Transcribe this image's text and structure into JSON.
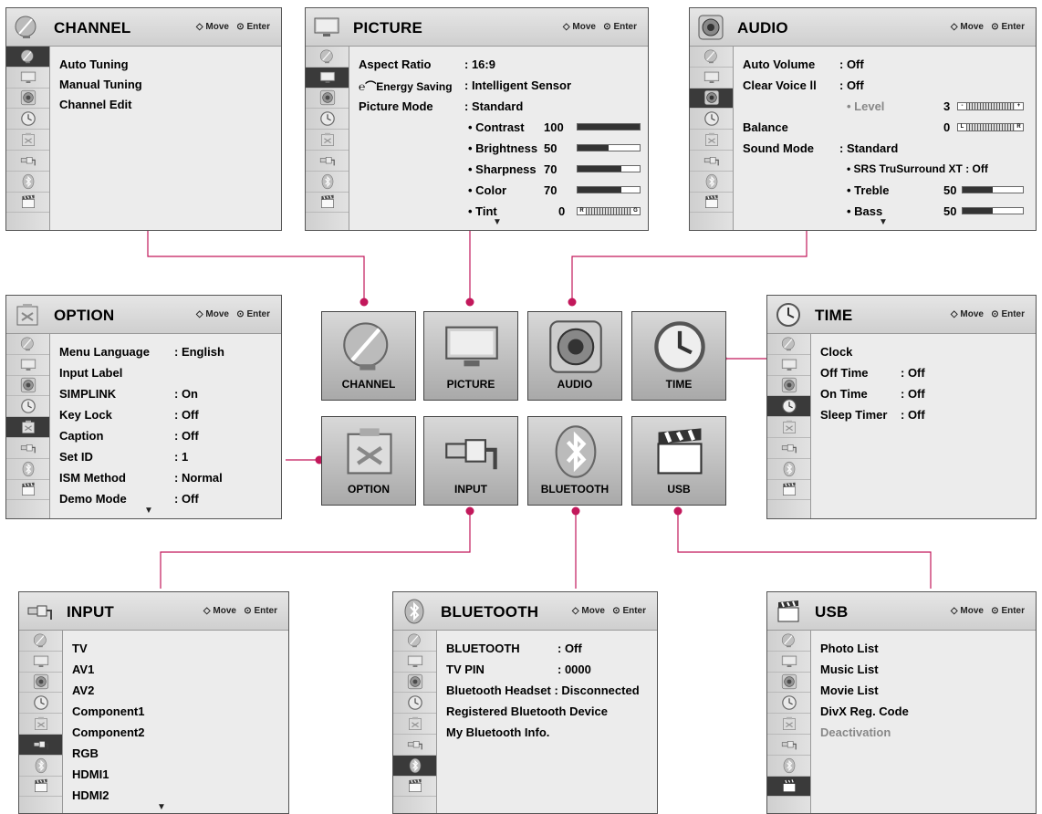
{
  "hint": {
    "move": "Move",
    "enter": "Enter"
  },
  "colors": {
    "connector": "#c2185b"
  },
  "sidebar_icons": [
    "channel-icon",
    "picture-icon",
    "audio-icon",
    "time-icon",
    "option-icon",
    "input-icon",
    "bluetooth-icon",
    "usb-icon"
  ],
  "channel": {
    "title": "CHANNEL",
    "items": [
      "Auto Tuning",
      "Manual Tuning",
      "Channel Edit"
    ]
  },
  "picture": {
    "title": "PICTURE",
    "rows": [
      {
        "label": "Aspect Ratio",
        "value": ": 16:9"
      },
      {
        "label": "Energy Saving",
        "value": ": Intelligent Sensor"
      },
      {
        "label": "Picture Mode",
        "value": ": Standard"
      },
      {
        "label": "• Contrast",
        "num": "100",
        "level": 1.0
      },
      {
        "label": "• Brightness",
        "num": "50",
        "level": 0.5
      },
      {
        "label": "• Sharpness",
        "num": "70",
        "level": 0.7
      },
      {
        "label": "• Color",
        "num": "70",
        "level": 0.7
      },
      {
        "label": "• Tint",
        "num": "0",
        "left": "R",
        "right": "G"
      }
    ]
  },
  "audio": {
    "title": "AUDIO",
    "rows": [
      {
        "label": "Auto Volume",
        "value": ": Off"
      },
      {
        "label": "Clear Voice ll",
        "value": ": Off"
      },
      {
        "label": "• Level",
        "num": "3",
        "left": "-",
        "right": "+"
      },
      {
        "label": "Balance",
        "num": "0",
        "left": "L",
        "right": "R"
      },
      {
        "label": "Sound Mode",
        "value": ": Standard"
      },
      {
        "label": "• SRS TruSurround XT : Off"
      },
      {
        "label": "• Treble",
        "num": "50",
        "level": 0.5
      },
      {
        "label": "• Bass",
        "num": "50",
        "level": 0.5
      }
    ]
  },
  "option": {
    "title": "OPTION",
    "rows": [
      {
        "label": "Menu Language",
        "value": ": English"
      },
      {
        "label": "Input Label",
        "value": ""
      },
      {
        "label": "SIMPLINK",
        "value": ": On"
      },
      {
        "label": "Key Lock",
        "value": ": Off"
      },
      {
        "label": "Caption",
        "value": ": Off"
      },
      {
        "label": "Set ID",
        "value": ": 1"
      },
      {
        "label": "ISM Method",
        "value": ": Normal"
      },
      {
        "label": "Demo Mode",
        "value": ": Off"
      }
    ]
  },
  "time": {
    "title": "TIME",
    "rows": [
      {
        "label": "Clock",
        "value": ""
      },
      {
        "label": "Off Time",
        "value": ": Off"
      },
      {
        "label": "On Time",
        "value": ": Off"
      },
      {
        "label": "Sleep Timer",
        "value": ": Off"
      }
    ]
  },
  "input": {
    "title": "INPUT",
    "items": [
      "TV",
      "AV1",
      "AV2",
      "Component1",
      "Component2",
      "RGB",
      "HDMI1",
      "HDMI2"
    ]
  },
  "bluetooth": {
    "title": "BLUETOOTH",
    "rows": [
      {
        "label": "BLUETOOTH",
        "value": ": Off"
      },
      {
        "label": "TV PIN",
        "value": ": 0000"
      },
      {
        "label": "Bluetooth Headset : Disconnected",
        "value": ""
      },
      {
        "label": "Registered Bluetooth Device",
        "value": ""
      },
      {
        "label": "My Bluetooth Info.",
        "value": ""
      }
    ]
  },
  "usb": {
    "title": "USB",
    "items": [
      "Photo List",
      "Music List",
      "Movie List",
      "DivX Reg. Code",
      "Deactivation"
    ]
  },
  "tiles": [
    "CHANNEL",
    "PICTURE",
    "AUDIO",
    "TIME",
    "OPTION",
    "INPUT",
    "BLUETOOTH",
    "USB"
  ]
}
